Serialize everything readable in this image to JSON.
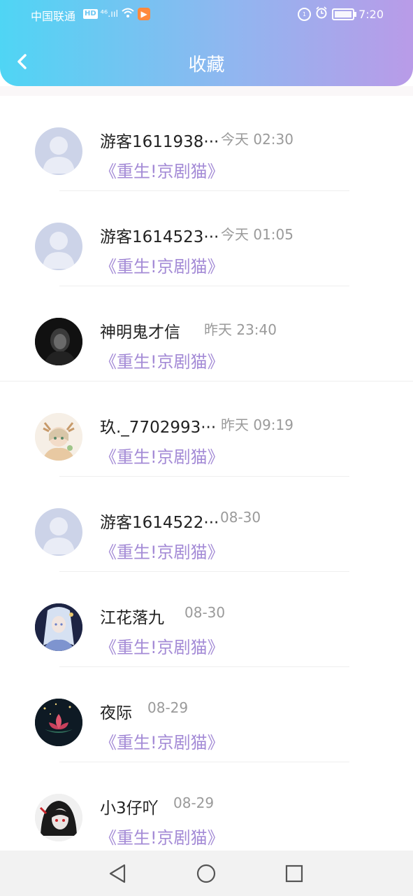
{
  "status_bar": {
    "carrier": "中国联通",
    "hd_badge": "HD",
    "signal_text": "⁴⁶.ııl",
    "time": "7:20",
    "icons": [
      "hd-icon",
      "signal-icon",
      "wifi-icon",
      "app-notification-icon",
      "data-saver-icon",
      "alarm-icon",
      "battery-icon"
    ]
  },
  "header": {
    "title": "收藏",
    "back_icon": "chevron-left-icon"
  },
  "favorites": [
    {
      "name": "游客1611938···",
      "day": "今天",
      "time": "02:30",
      "work": "《重生!京剧猫》",
      "avatar": "default"
    },
    {
      "name": "游客1614523···",
      "day": "今天",
      "time": "01:05",
      "work": "《重生!京剧猫》",
      "avatar": "default"
    },
    {
      "name": "神明鬼才信",
      "day": "昨天",
      "time": "23:40",
      "work": "《重生!京剧猫》",
      "avatar": "dark-portrait"
    },
    {
      "name": "玖._7702993···",
      "day": "昨天",
      "time": "09:19",
      "work": "《重生!京剧猫》",
      "avatar": "deer-girl"
    },
    {
      "name": "游客1614522···",
      "day": "",
      "time": "08-30",
      "work": "《重生!京剧猫》",
      "avatar": "default"
    },
    {
      "name": "江花落九",
      "day": "",
      "time": "08-30",
      "work": "《重生!京剧猫》",
      "avatar": "silver-hair-girl"
    },
    {
      "name": "夜际",
      "day": "",
      "time": "08-29",
      "work": "《重生!京剧猫》",
      "avatar": "red-lotus"
    },
    {
      "name": "小3仔吖",
      "day": "",
      "time": "08-29",
      "work": "《重生!京剧猫》",
      "avatar": "red-eye-portrait"
    }
  ],
  "nav": [
    "back-triangle-icon",
    "home-circle-icon",
    "recents-square-icon"
  ]
}
